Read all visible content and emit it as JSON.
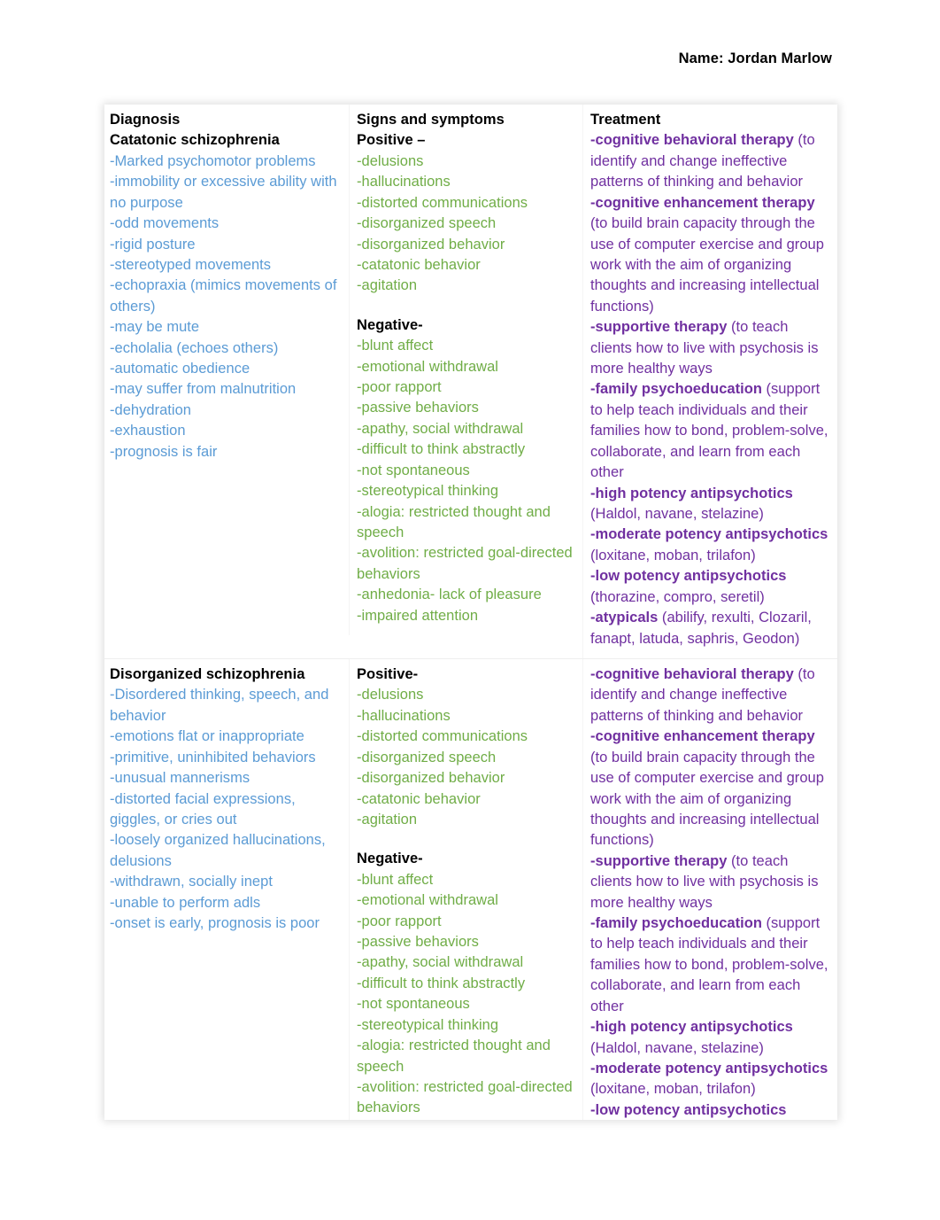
{
  "document": {
    "name_line": "Name: Jordan Marlow"
  },
  "colors": {
    "diagnosis_text": "#5b9bd5",
    "symptoms_text": "#70ad47",
    "treatment_text": "#7030a0",
    "header_text": "#000000",
    "page_background": "#ffffff"
  },
  "table": {
    "headers": {
      "col1": "Diagnosis",
      "col2": "Signs and symptoms",
      "col3": "Treatment"
    },
    "rows": [
      {
        "diagnosis": {
          "title": "Catatonic schizophrenia",
          "items": [
            "-Marked psychomotor problems",
            "-immobility or excessive ability with no purpose",
            "-odd movements",
            "-rigid posture",
            "-stereotyped movements",
            "-echopraxia (mimics movements of others)",
            "-may be mute",
            "-echolalia (echoes others)",
            "-automatic obedience",
            "-may suffer from malnutrition",
            "-dehydration",
            "-exhaustion",
            "-prognosis is fair"
          ]
        },
        "symptoms": {
          "positive_title": "Positive –",
          "positive_items": [
            "-delusions",
            "-hallucinations",
            "-distorted communications",
            "-disorganized speech",
            "-disorganized behavior",
            "-catatonic behavior",
            "-agitation"
          ],
          "negative_title": "Negative-",
          "negative_items": [
            "-blunt affect",
            "-emotional withdrawal",
            "-poor rapport",
            "-passive behaviors",
            "-apathy, social withdrawal",
            "-difficult to think abstractly",
            "-not spontaneous",
            "-stereotypical thinking",
            "-alogia: restricted thought and speech",
            "-avolition: restricted goal-directed behaviors",
            "-anhedonia- lack of pleasure",
            "-impaired attention"
          ]
        },
        "treatment": [
          {
            "bold": "-cognitive behavioral therapy",
            "rest": " (to identify and change ineffective patterns of thinking and behavior"
          },
          {
            "bold": "-cognitive enhancement therapy",
            "rest": " (to build brain capacity through the use of computer exercise and group work with the aim of organizing thoughts and increasing intellectual functions)"
          },
          {
            "bold": "-supportive therapy",
            "rest": " (to teach clients how to live with psychosis is more healthy ways"
          },
          {
            "bold": "-family psychoeducation",
            "rest": " (support to help teach individuals and their families how to bond, problem-solve, collaborate, and learn from each other"
          },
          {
            "bold": "-high potency antipsychotics",
            "rest": " (Haldol, navane, stelazine)"
          },
          {
            "bold": "-moderate potency antipsychotics",
            "rest": " (loxitane, moban, trilafon)"
          },
          {
            "bold": "-low potency antipsychotics",
            "rest": " (thorazine, compro, seretil)"
          },
          {
            "bold": "-atypicals",
            "rest": " (abilify, rexulti, Clozaril, fanapt, latuda, saphris, Geodon)"
          }
        ]
      },
      {
        "diagnosis": {
          "title": "Disorganized schizophrenia",
          "items": [
            "-Disordered thinking, speech, and behavior",
            "-emotions flat or inappropriate",
            "-primitive, uninhibited behaviors",
            "-unusual mannerisms",
            "-distorted facial expressions, giggles, or cries out",
            "-loosely organized hallucinations, delusions",
            "-withdrawn, socially inept",
            "-unable to perform adls",
            "-onset is early, prognosis is poor"
          ]
        },
        "symptoms": {
          "positive_title": "Positive-",
          "positive_items": [
            "-delusions",
            "-hallucinations",
            "-distorted communications",
            "-disorganized speech",
            "-disorganized behavior",
            "-catatonic behavior",
            "-agitation"
          ],
          "negative_title": "Negative-",
          "negative_items": [
            "-blunt affect",
            "-emotional withdrawal",
            "-poor rapport",
            "-passive behaviors",
            "-apathy, social withdrawal",
            "-difficult to think abstractly",
            "-not spontaneous",
            "-stereotypical thinking",
            "-alogia: restricted thought and speech",
            "-avolition: restricted goal-directed behaviors"
          ]
        },
        "treatment": [
          {
            "bold": "-cognitive behavioral therapy",
            "rest": " (to identify and change ineffective patterns of thinking and behavior"
          },
          {
            "bold": "-cognitive enhancement therapy",
            "rest": " (to build brain capacity through the use of computer exercise and group work with the aim of organizing thoughts and increasing intellectual functions)"
          },
          {
            "bold": "-supportive therapy",
            "rest": " (to teach clients how to live with psychosis is more healthy ways"
          },
          {
            "bold": "-family psychoeducation",
            "rest": " (support to help teach individuals and their families how to bond, problem-solve, collaborate, and learn from each other"
          },
          {
            "bold": "-high potency antipsychotics",
            "rest": " (Haldol, navane, stelazine)"
          },
          {
            "bold": "-moderate potency antipsychotics",
            "rest": " (loxitane, moban, trilafon)"
          },
          {
            "bold": "-low potency antipsychotics",
            "rest": ""
          }
        ]
      }
    ]
  }
}
